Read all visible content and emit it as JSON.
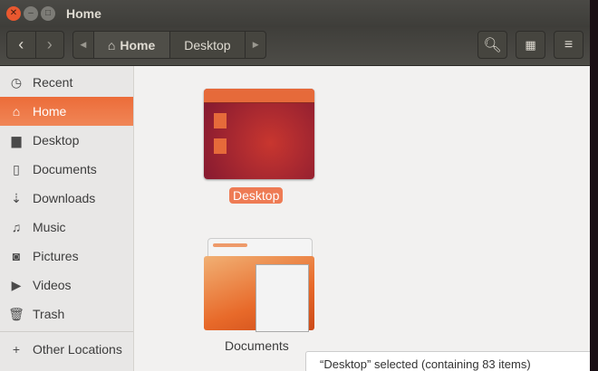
{
  "window": {
    "title": "Home"
  },
  "path": {
    "home": "Home",
    "desktop": "Desktop"
  },
  "sidebar": {
    "items": [
      {
        "label": "Recent",
        "icon": "clock-icon"
      },
      {
        "label": "Home",
        "icon": "home-icon"
      },
      {
        "label": "Desktop",
        "icon": "folder-icon"
      },
      {
        "label": "Documents",
        "icon": "document-icon"
      },
      {
        "label": "Downloads",
        "icon": "download-icon"
      },
      {
        "label": "Music",
        "icon": "music-icon"
      },
      {
        "label": "Pictures",
        "icon": "camera-icon"
      },
      {
        "label": "Videos",
        "icon": "video-icon"
      },
      {
        "label": "Trash",
        "icon": "trash-icon"
      }
    ],
    "other": "Other Locations"
  },
  "files": [
    {
      "name": "Desktop"
    },
    {
      "name": "Documents"
    }
  ],
  "status": "“Desktop” selected  (containing 83 items)",
  "colors": {
    "accent": "#ed6f3e"
  }
}
